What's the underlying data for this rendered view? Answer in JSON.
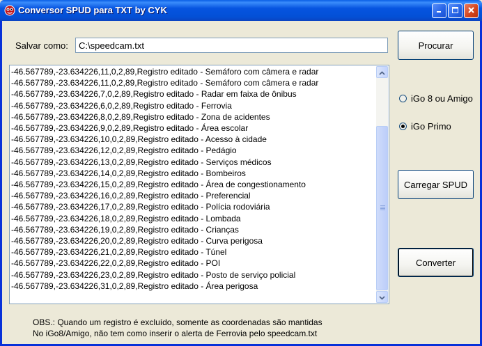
{
  "window": {
    "title": "Conversor SPUD para TXT by CYK"
  },
  "save": {
    "label": "Salvar como:",
    "value": "C:\\speedcam.txt"
  },
  "buttons": {
    "browse": "Procurar",
    "load": "Carregar SPUD",
    "convert": "Converter"
  },
  "options": {
    "igo8": "iGo 8 ou Amigo",
    "igo_primo": "iGo Primo",
    "selected": "igo_primo"
  },
  "records": [
    "-46.567789,-23.634226,11,0,2,89,Registro editado - Semáforo com câmera e radar",
    "-46.567789,-23.634226,11,0,2,89,Registro editado - Semáforo com câmera e radar",
    "-46.567789,-23.634226,7,0,2,89,Registro editado - Radar em faixa de ônibus",
    "-46.567789,-23.634226,6,0,2,89,Registro editado - Ferrovia",
    "-46.567789,-23.634226,8,0,2,89,Registro editado - Zona de acidentes",
    "-46.567789,-23.634226,9,0,2,89,Registro editado - Área escolar",
    "-46.567789,-23.634226,10,0,2,89,Registro editado - Acesso à cidade",
    "-46.567789,-23.634226,12,0,2,89,Registro editado - Pedágio",
    "-46.567789,-23.634226,13,0,2,89,Registro editado - Serviços médicos",
    "-46.567789,-23.634226,14,0,2,89,Registro editado - Bombeiros",
    "-46.567789,-23.634226,15,0,2,89,Registro editado - Área de congestionamento",
    "-46.567789,-23.634226,16,0,2,89,Registro editado - Preferencial",
    "-46.567789,-23.634226,17,0,2,89,Registro editado - Polícia rodoviária",
    "-46.567789,-23.634226,18,0,2,89,Registro editado - Lombada",
    "-46.567789,-23.634226,19,0,2,89,Registro editado - Crianças",
    "-46.567789,-23.634226,20,0,2,89,Registro editado - Curva perigosa",
    "-46.567789,-23.634226,21,0,2,89,Registro editado - Túnel",
    "-46.567789,-23.634226,22,0,2,89,Registro editado - POI",
    "-46.567789,-23.634226,23,0,2,89,Registro editado - Posto de serviço policial",
    "-46.567789,-23.634226,31,0,2,89,Registro editado - Área perigosa"
  ],
  "notes": {
    "line1": "OBS.: Quando um registro é excluído, somente as coordenadas são mantidas",
    "line2": "No iGo8/Amigo, não tem como inserir o alerta de Ferrovia pelo speedcam.txt"
  },
  "colors": {
    "titlebar": "#0654e0",
    "face": "#ece9d8",
    "border": "#7f9db9"
  },
  "icons": {
    "app": "red-frog-icon",
    "minimize": "minimize-icon",
    "maximize": "maximize-icon",
    "close": "close-icon",
    "scroll_up": "scroll-up-arrow-icon",
    "scroll_down": "scroll-down-arrow-icon"
  }
}
